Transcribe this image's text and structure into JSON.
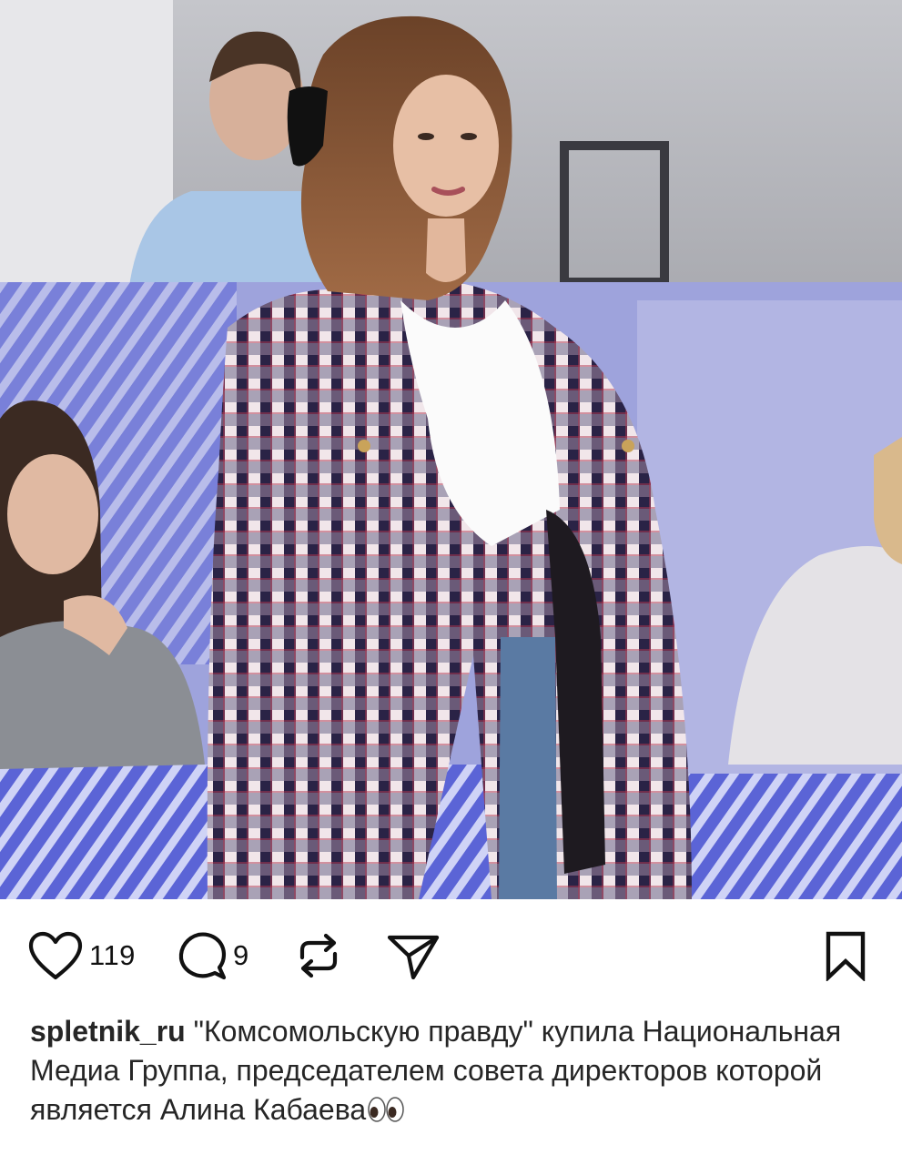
{
  "post": {
    "likes": "119",
    "comments": "9",
    "username": "spletnik_ru",
    "caption": "\"Комсомольскую правду\" купила Национальная Медиа Группа, председателем совета директоров которой является Алина Кабаева",
    "caption_emoji": "👀"
  },
  "icons": {
    "like": "heart-icon",
    "comment": "speech-bubble-icon",
    "repost": "repost-arrows-icon",
    "share": "paper-plane-icon",
    "save": "bookmark-icon"
  },
  "colors": {
    "text": "#262626",
    "background": "#ffffff",
    "icon": "#111111"
  }
}
